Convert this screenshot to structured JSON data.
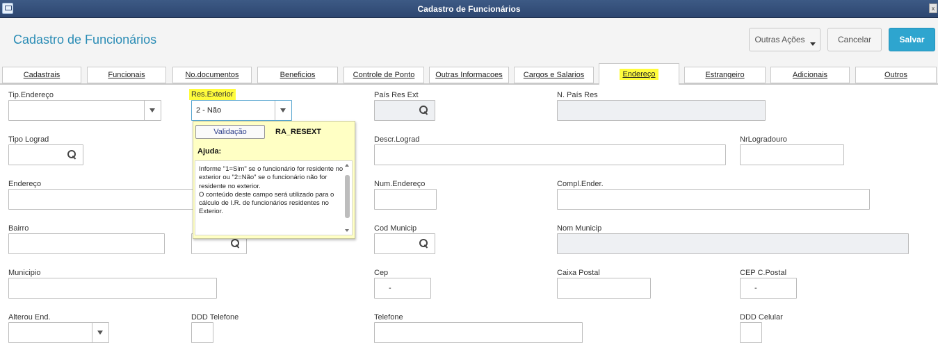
{
  "window": {
    "title": "Cadastro de Funcionários",
    "close_glyph": "x"
  },
  "header": {
    "title": "Cadastro de Funcionários"
  },
  "toolbar": {
    "more_actions": "Outras Ações",
    "cancel": "Cancelar",
    "save": "Salvar"
  },
  "tabs": [
    "Cadastrais",
    "Funcionais",
    "No.documentos",
    "Beneficios",
    "Controle de Ponto",
    "Outras Informacoes",
    "Cargos e Salarios",
    "Endereço",
    "Estrangeiro",
    "Adicionais",
    "Outros"
  ],
  "active_tab": "Endereço",
  "fields": {
    "tip_endereco": {
      "label": "Tip.Endereço",
      "value": ""
    },
    "res_exterior": {
      "label": "Res.Exterior",
      "value": "2 - Não"
    },
    "pais_res_ext": {
      "label": "País Res Ext"
    },
    "n_pais_res": {
      "label": "N. País Res"
    },
    "tipo_lograd": {
      "label": "Tipo Lograd"
    },
    "descr_lograd": {
      "label": "Descr.Lograd"
    },
    "nr_logradouro": {
      "label": "NrLogradouro"
    },
    "endereco": {
      "label": "Endereço"
    },
    "num_endereco": {
      "label": "Num.Endereço"
    },
    "compl_ender": {
      "label": "Compl.Ender."
    },
    "bairro": {
      "label": "Bairro"
    },
    "cod_municip": {
      "label": "Cod Municip"
    },
    "nom_municip": {
      "label": "Nom Municip"
    },
    "municipio": {
      "label": "Municipio"
    },
    "cep": {
      "label": "Cep",
      "value": "-"
    },
    "caixa_postal": {
      "label": "Caixa Postal"
    },
    "cep_c_postal": {
      "label": "CEP C.Postal",
      "value": "-"
    },
    "alterou_end": {
      "label": "Alterou End."
    },
    "ddd_telefone": {
      "label": "DDD Telefone"
    },
    "telefone": {
      "label": "Telefone"
    },
    "ddd_celular": {
      "label": "DDD Celular"
    }
  },
  "help_popup": {
    "validation_button": "Validação",
    "field_code": "RA_RESEXT",
    "heading": "Ajuda:",
    "text": "Informe \"1=Sim\" se o funcionário for residente no exterior ou \"2=Não\" se o funcionário não for residente no exterior.\nO conteúdo deste campo será utilizado para o cálculo de I.R. de funcionários residentes no Exterior."
  },
  "colors": {
    "accent": "#2ea5cf",
    "title": "#2a8cb5",
    "titlebar": "#2d4670",
    "highlight": "#fffc3c",
    "popup_bg": "#ffffc4"
  }
}
